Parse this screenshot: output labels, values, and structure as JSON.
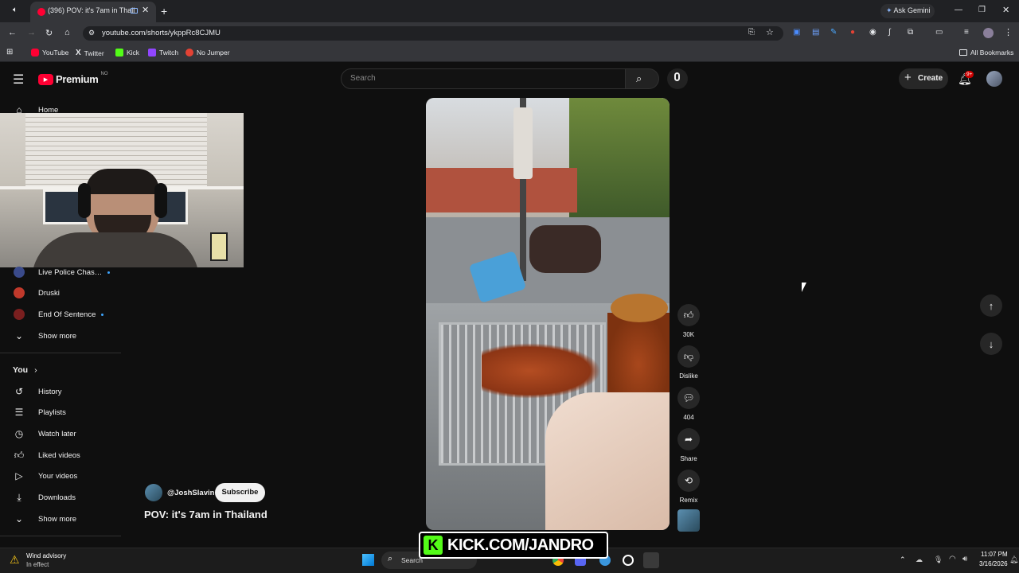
{
  "browser": {
    "tab_title": "(396) POV: it's 7am in Thail…",
    "tab_close": "✕",
    "new_tab": "+",
    "ask_gemini": "Ask Gemini",
    "url": "youtube.com/shorts/ykppRc8CJMU",
    "window_controls": [
      "—",
      "❐",
      "✕"
    ],
    "bookmarks": [
      {
        "label": "YouTube",
        "color": "#ff0033"
      },
      {
        "label": "Twitter",
        "color": "#e8eaed"
      },
      {
        "label": "Kick",
        "color": "#53fc18"
      },
      {
        "label": "Twitch",
        "color": "#9146ff"
      },
      {
        "label": "No Jumper",
        "color": "#e34234"
      }
    ],
    "all_bookmarks": "All Bookmarks"
  },
  "youtube": {
    "logo_text": "Premium",
    "logo_region": "NO",
    "search_placeholder": "Search",
    "create_label": "Create",
    "notif_count": "9+",
    "sidebar": {
      "home": "Home",
      "subscriptions": [
        {
          "name": "Live Police Chas…",
          "live_dot": true,
          "color": "#3a4a8a"
        },
        {
          "name": "Druski",
          "live_dot": false,
          "color": "#c0392b"
        },
        {
          "name": "End Of Sentence",
          "live_dot": true,
          "color": "#7a1f1f"
        }
      ],
      "show_more_1": "Show more",
      "you_label": "You",
      "you_items": [
        {
          "label": "History",
          "icon": "history-icon"
        },
        {
          "label": "Playlists",
          "icon": "playlists-icon"
        },
        {
          "label": "Watch later",
          "icon": "clock-icon"
        },
        {
          "label": "Liked videos",
          "icon": "thumbs-up-icon"
        },
        {
          "label": "Your videos",
          "icon": "play-icon"
        },
        {
          "label": "Downloads",
          "icon": "download-icon"
        }
      ],
      "show_more_2": "Show more"
    },
    "short": {
      "channel": "@JoshSlavin",
      "subscribe": "Subscribe",
      "title": "POV: it's 7am in Thailand",
      "likes": "30K",
      "dislike": "Dislike",
      "comments": "404",
      "share": "Share",
      "remix": "Remix"
    }
  },
  "overlay": {
    "kick_letter": "K",
    "kick_text": "KICK.COM/JANDRO"
  },
  "taskbar": {
    "weather_title": "Wind advisory",
    "weather_sub": "In effect",
    "search": "Search",
    "time": "11:07 PM",
    "date": "3/16/2026"
  }
}
